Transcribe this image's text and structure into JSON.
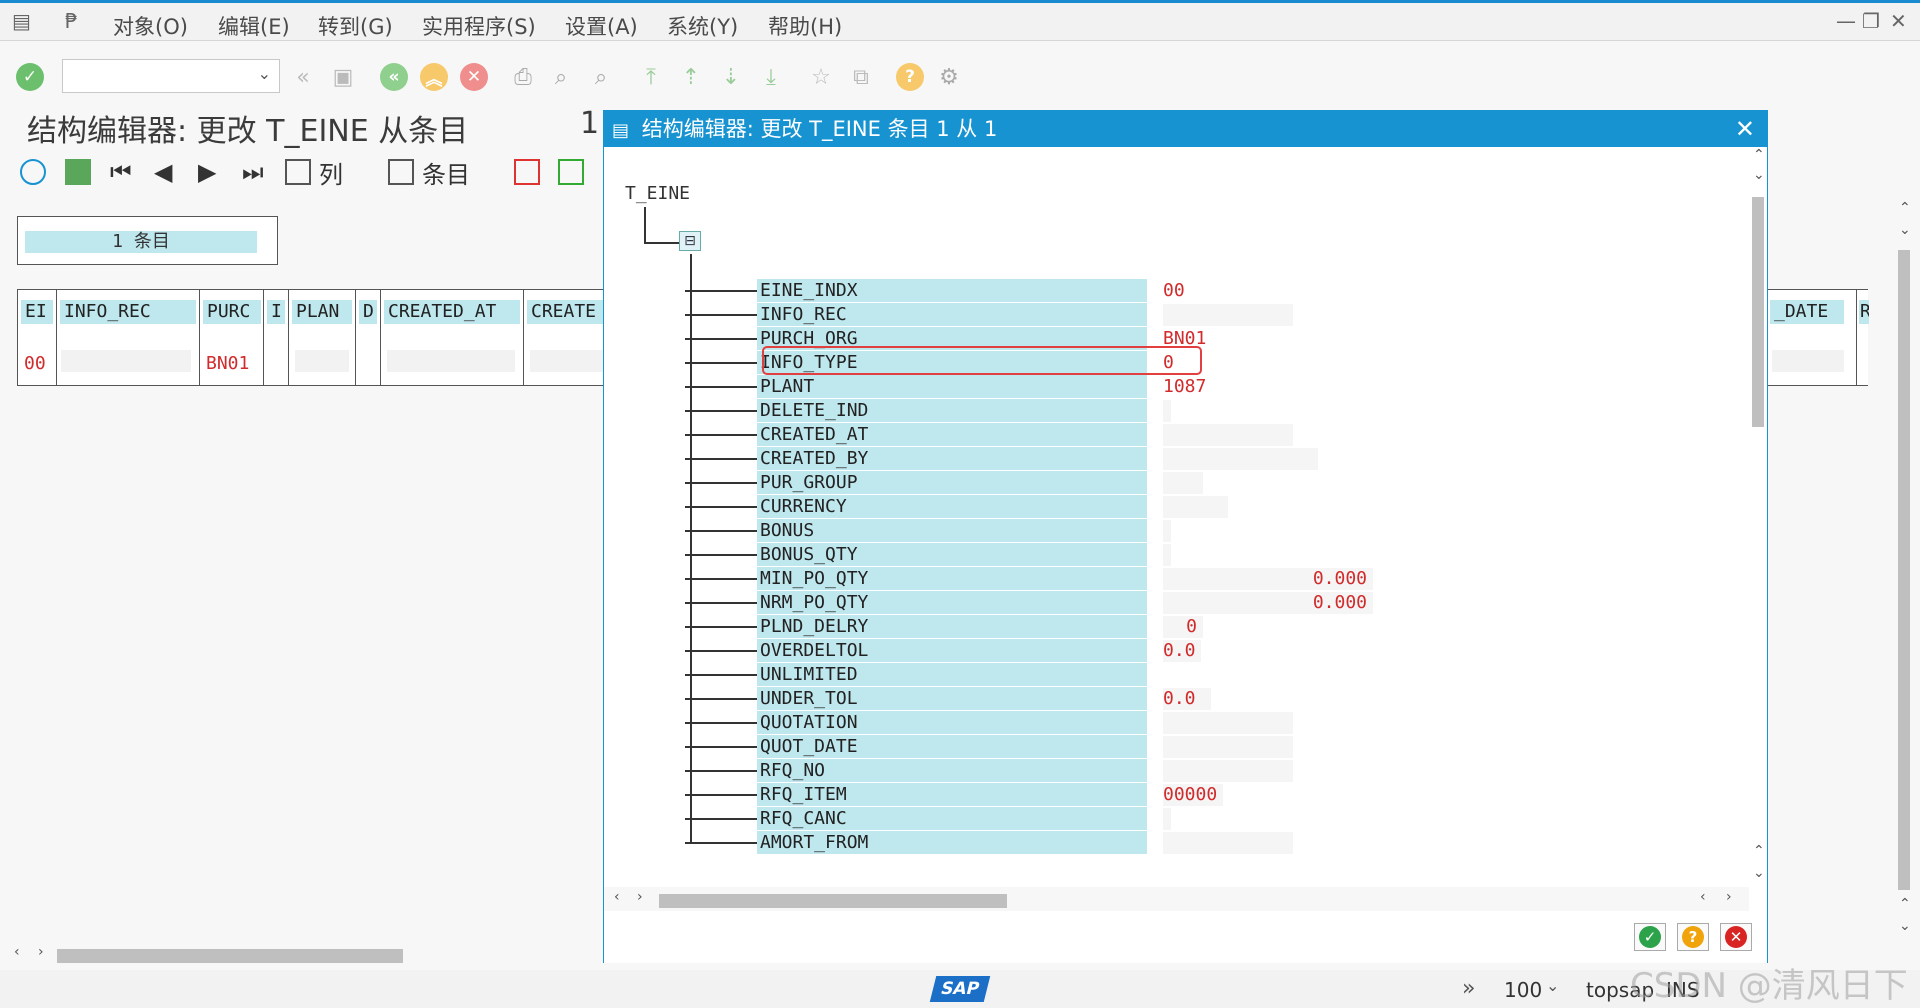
{
  "menu": {
    "items": [
      "对象(O)",
      "编辑(E)",
      "转到(G)",
      "实用程序(S)",
      "设置(A)",
      "系统(Y)",
      "帮助(H)"
    ]
  },
  "main": {
    "title": "结构编辑器: 更改 T_EINE 从条目",
    "title_suffix": "1",
    "toolbar": {
      "columns_label": "列",
      "entries_label": "条目"
    },
    "entries_count": "1  条目",
    "table": {
      "headers": [
        "EI",
        "INFO_REC",
        "PURC",
        "I",
        "PLAN",
        "D",
        "CREATED_AT",
        "CREATE"
      ],
      "row": [
        "00",
        "",
        "BN01",
        "",
        "",
        "",
        "",
        ""
      ],
      "right_headers": [
        "_DATE",
        "R"
      ]
    }
  },
  "dialog": {
    "title": "结构编辑器: 更改 T_EINE 条目 1 从 1",
    "root": "T_EINE",
    "fields": [
      {
        "name": "EINE_INDX",
        "value": "00"
      },
      {
        "name": "INFO_REC",
        "value": ""
      },
      {
        "name": "PURCH_ORG",
        "value": "BN01"
      },
      {
        "name": "INFO_TYPE",
        "value": "0"
      },
      {
        "name": "PLANT",
        "value": "1087"
      },
      {
        "name": "DELETE_IND",
        "value": ""
      },
      {
        "name": "CREATED_AT",
        "value": ""
      },
      {
        "name": "CREATED_BY",
        "value": ""
      },
      {
        "name": "PUR_GROUP",
        "value": ""
      },
      {
        "name": "CURRENCY",
        "value": ""
      },
      {
        "name": "BONUS",
        "value": ""
      },
      {
        "name": "BONUS_QTY",
        "value": ""
      },
      {
        "name": "MIN_PO_QTY",
        "value": "0.000"
      },
      {
        "name": "NRM_PO_QTY",
        "value": "0.000"
      },
      {
        "name": "PLND_DELRY",
        "value": "0"
      },
      {
        "name": "OVERDELTOL",
        "value": "0.0"
      },
      {
        "name": "UNLIMITED",
        "value": ""
      },
      {
        "name": "UNDER_TOL",
        "value": "0.0"
      },
      {
        "name": "QUOTATION",
        "value": ""
      },
      {
        "name": "QUOT_DATE",
        "value": ""
      },
      {
        "name": "RFQ_NO",
        "value": ""
      },
      {
        "name": "RFQ_ITEM",
        "value": "00000"
      },
      {
        "name": "RFQ_CANC",
        "value": ""
      },
      {
        "name": "AMORT_FROM",
        "value": ""
      }
    ]
  },
  "status": {
    "sap_logo": "SAP",
    "zoom": "100",
    "system": "topsap",
    "mode": "INS"
  },
  "watermark": "CSDN @清风日下",
  "colors": {
    "accent": "#1793d1",
    "field_bg": "#bfe7ee",
    "value": "#d12b2b",
    "highlight": "#e24040"
  }
}
